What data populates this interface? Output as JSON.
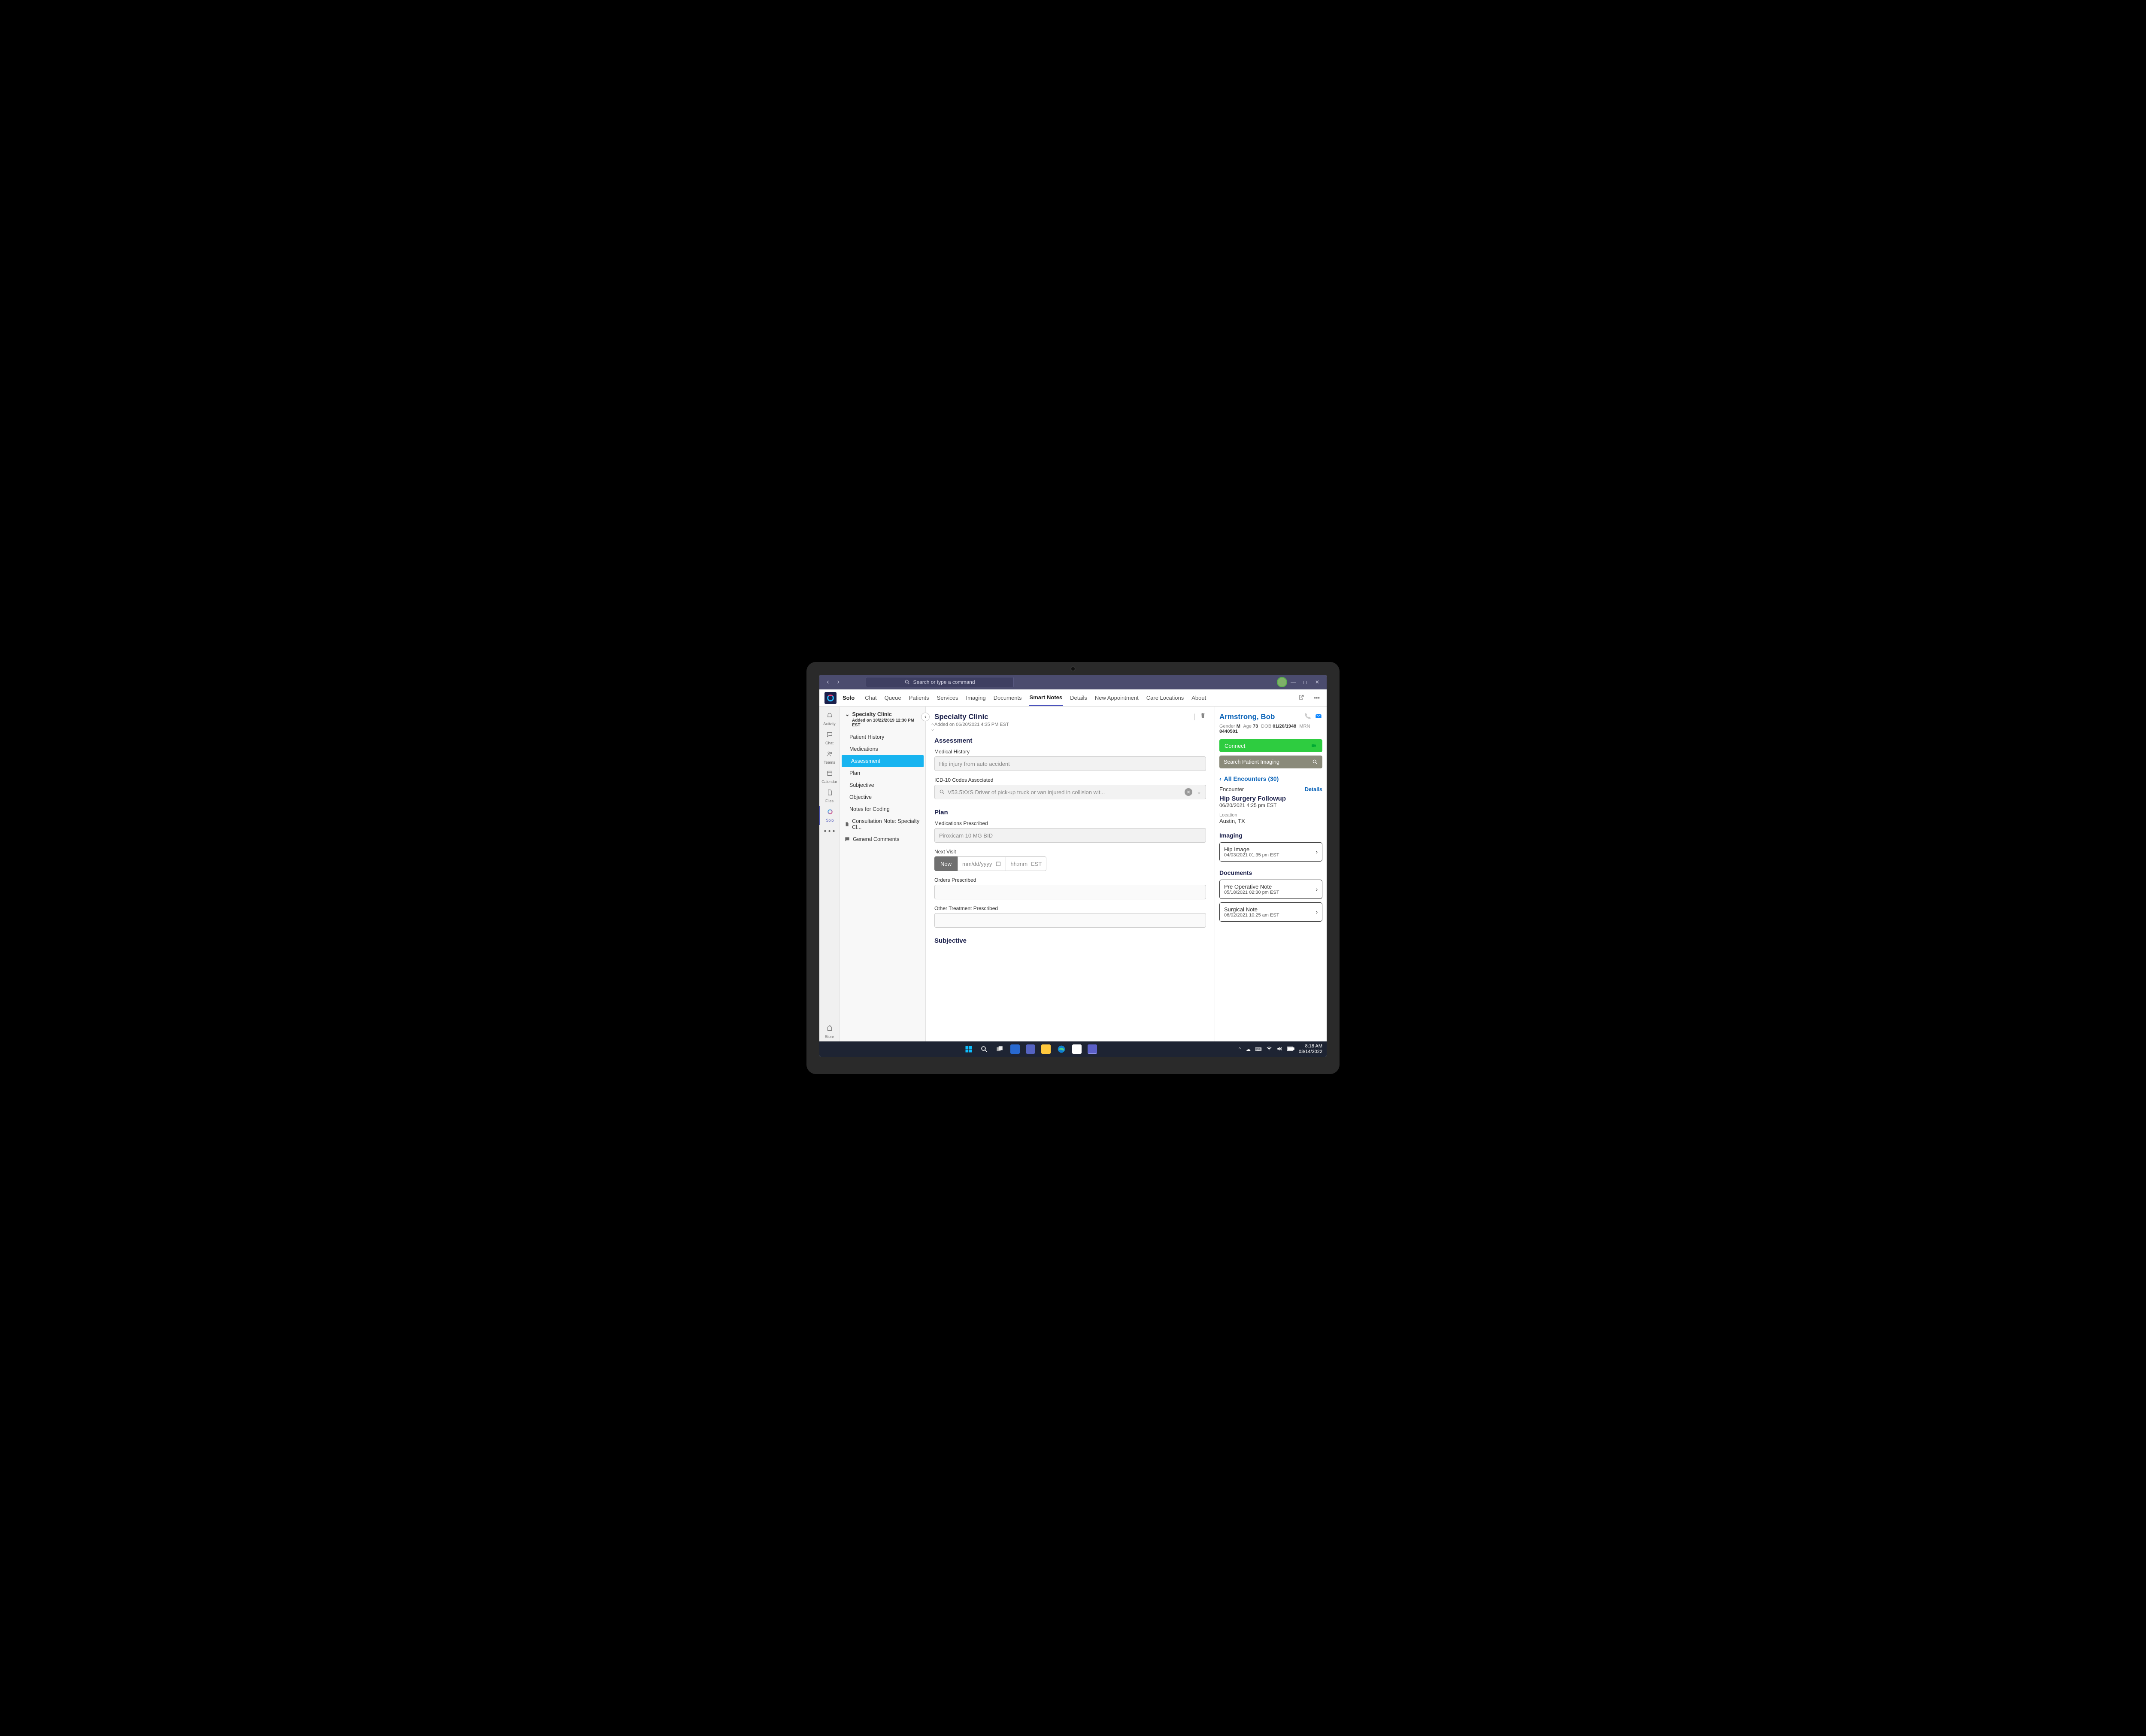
{
  "titlebar": {
    "search_placeholder": "Search or type a command"
  },
  "app": {
    "name": "Solo",
    "tabs": [
      "Chat",
      "Queue",
      "Patients",
      "Services",
      "Imaging",
      "Documents",
      "Smart Notes",
      "Details",
      "New Appointment",
      "Care Locations",
      "About"
    ],
    "active_tab": "Smart Notes"
  },
  "rail": [
    {
      "label": "Activity",
      "icon": "bell"
    },
    {
      "label": "Chat",
      "icon": "chat"
    },
    {
      "label": "Teams",
      "icon": "people"
    },
    {
      "label": "Calendar",
      "icon": "cal"
    },
    {
      "label": "Files",
      "icon": "file"
    },
    {
      "label": "Solo",
      "icon": "solo",
      "active": true
    },
    {
      "label": "",
      "icon": "more"
    }
  ],
  "rail_bottom": {
    "label": "Store",
    "icon": "store"
  },
  "sidebar": {
    "title": "Specialty Clinic",
    "added": "Added on 10/22/2019 12:30 PM EST",
    "items": [
      "Patient History",
      "Medications",
      "Assessment",
      "Plan",
      "Subjective",
      "Objective",
      "Notes for Coding"
    ],
    "active": "Assessment",
    "extra": [
      {
        "icon": "doc",
        "label": "Consultation Note: Specialty Cl..."
      },
      {
        "icon": "comment",
        "label": "General Comments"
      }
    ]
  },
  "content": {
    "title": "Specialty Clinic",
    "added": "Added on 06/20/2021 4:35 PM EST",
    "sections": {
      "assessment": {
        "title": "Assessment",
        "med_history_label": "Medical History",
        "med_history_value": "Hip injury from auto accident",
        "icd_label": "ICD-10 Codes Associated",
        "icd_value": "V53.5XXS Driver of pick-up truck or van injured in collision wit..."
      },
      "plan": {
        "title": "Plan",
        "meds_label": "Medications Prescribed",
        "meds_value": "Piroxicam 10 MG BID",
        "next_label": "Next Visit",
        "now": "Now",
        "date_ph": "mm/dd/yyyy",
        "time_ph": "hh:mm",
        "tz": "EST",
        "orders_label": "Orders Prescribed",
        "other_label": "Other Treatment Prescribed"
      },
      "subjective": {
        "title": "Subjective"
      }
    }
  },
  "patient": {
    "name": "Armstrong, Bob",
    "gender_k": "Gender",
    "gender_v": "M",
    "age_k": "Age",
    "age_v": "73",
    "dob_k": "DOB",
    "dob_v": "01/20/1948",
    "mrn_k": "MRN",
    "mrn_v": "8440501",
    "connect": "Connect",
    "search_ph": "Search Patient Imaging",
    "enc_link": "All Encounters (30)",
    "enc_label": "Encounter",
    "details": "Details",
    "enc_title": "Hip Surgery Followup",
    "enc_date": "06/20/2021 4:25 pm EST",
    "loc_label": "Location",
    "loc_value": "Austin, TX",
    "imaging_h": "Imaging",
    "imaging": [
      {
        "title": "Hip Image",
        "date": "04/03/2021 01:35 pm EST"
      }
    ],
    "docs_h": "Documents",
    "docs": [
      {
        "title": "Pre Operative Note",
        "date": "05/18/2021 02:30 pm EST"
      },
      {
        "title": "Surgical Note",
        "date": "06/02/2021 10:25 am EST"
      }
    ]
  },
  "taskbar": {
    "time": "8:18 AM",
    "date": "03/14/2022"
  }
}
